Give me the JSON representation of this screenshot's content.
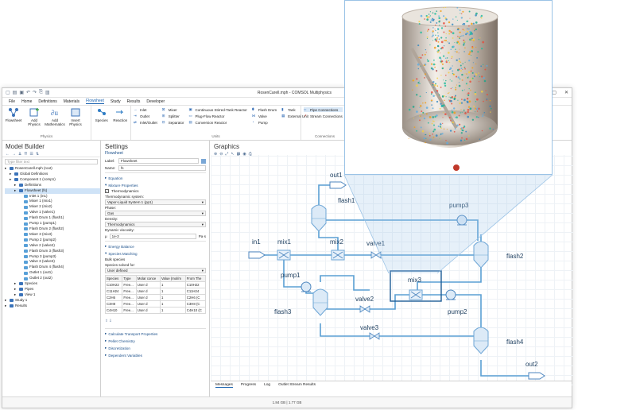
{
  "window": {
    "title": "RosenCarell.mph - COMSOL Multiphysics"
  },
  "menu": [
    "File",
    "Home",
    "Definitions",
    "Materials",
    "Flowsheet",
    "Study",
    "Results",
    "Developer"
  ],
  "menu_active": "Flowsheet",
  "ribbon": {
    "groups": [
      {
        "label": "Physics",
        "buttons": [
          "Flowsheet",
          "Add Physics",
          "Add Mathematics",
          "Insert Physics"
        ]
      },
      {
        "label": "",
        "buttons": [
          "Species",
          "Reaction"
        ]
      },
      {
        "label": "Units",
        "col1": [
          "Inlet",
          "Outlet",
          "Inlet/Outlet"
        ],
        "col2": [
          "Mixer",
          "Splitter",
          "Separator"
        ],
        "col3": [
          "Continuous Stirred-Tank Reactor",
          "Plug-Flow Reactor",
          "Conversion Reactor"
        ],
        "col4": [
          "Flash Drum",
          "Valve",
          "Pump"
        ],
        "col5": [
          "Tank",
          "External Unit"
        ]
      },
      {
        "label": "Connections",
        "col1": [
          "Pipe Connections",
          "Stream Connections"
        ]
      }
    ]
  },
  "model_builder": {
    "title": "Model Builder",
    "filter_placeholder": "Type filter text",
    "tree": [
      {
        "label": "RosenCarell.mph (root)",
        "level": 0,
        "color": "#3b73b9"
      },
      {
        "label": "Global Definitions",
        "level": 1,
        "color": "#3b73b9"
      },
      {
        "label": "Component 1 (comp1)",
        "level": 1,
        "color": "#3b73b9"
      },
      {
        "label": "Definitions",
        "level": 2,
        "color": "#3b73b9"
      },
      {
        "label": "Flowsheet (fs)",
        "level": 2,
        "color": "#3b73b9",
        "selected": true
      },
      {
        "label": "Inlet 1 (in1)",
        "level": 3,
        "color": "#58a0d8"
      },
      {
        "label": "Mixer 1 (mix1)",
        "level": 3,
        "color": "#58a0d8"
      },
      {
        "label": "Mixer 2 (mix2)",
        "level": 3,
        "color": "#58a0d8"
      },
      {
        "label": "Valve 1 (valve1)",
        "level": 3,
        "color": "#58a0d8"
      },
      {
        "label": "Flash Drum 1 (flash1)",
        "level": 3,
        "color": "#58a0d8"
      },
      {
        "label": "Pump 1 (pump1)",
        "level": 3,
        "color": "#58a0d8"
      },
      {
        "label": "Flash Drum 2 (flash2)",
        "level": 3,
        "color": "#58a0d8"
      },
      {
        "label": "Mixer 3 (mix3)",
        "level": 3,
        "color": "#58a0d8"
      },
      {
        "label": "Pump 2 (pump2)",
        "level": 3,
        "color": "#58a0d8"
      },
      {
        "label": "Valve 2 (valve2)",
        "level": 3,
        "color": "#58a0d8"
      },
      {
        "label": "Flash Drum 3 (flash3)",
        "level": 3,
        "color": "#58a0d8"
      },
      {
        "label": "Pump 3 (pump3)",
        "level": 3,
        "color": "#58a0d8"
      },
      {
        "label": "Valve 3 (valve3)",
        "level": 3,
        "color": "#58a0d8"
      },
      {
        "label": "Flash Drum 4 (flash4)",
        "level": 3,
        "color": "#58a0d8"
      },
      {
        "label": "Outlet 1 (out1)",
        "level": 3,
        "color": "#58a0d8"
      },
      {
        "label": "Outlet 2 (out2)",
        "level": 3,
        "color": "#58a0d8"
      },
      {
        "label": "Species",
        "level": 2,
        "color": "#3b73b9"
      },
      {
        "label": "Pipes",
        "level": 2,
        "color": "#3b73b9"
      },
      {
        "label": "View 1",
        "level": 2,
        "color": "#3b73b9"
      },
      {
        "label": "Study 1",
        "level": 0,
        "color": "#3b73b9"
      },
      {
        "label": "Results",
        "level": 0,
        "color": "#3b73b9"
      }
    ]
  },
  "settings": {
    "title": "Settings",
    "subtitle": "Flowsheet",
    "label_field": {
      "label": "Label:",
      "value": "Flowsheet"
    },
    "name_field": {
      "label": "Name:",
      "value": "fs"
    },
    "sections": {
      "equation": "Equation",
      "mixture": "Mixture Properties",
      "energy": "Energy Balance",
      "species_matching": "Species Matching",
      "transport": "Calculate Transport Properties",
      "pellet": "Pellet Chemistry",
      "discretization": "Discretization",
      "dependent": "Dependent Variables"
    },
    "thermo_checkbox": "Thermodynamics",
    "thermo_system_label": "Thermodynamic system:",
    "thermo_system_value": "Vapor-Liquid System 1 (pp1)",
    "phase_label": "Phase:",
    "phase_value": "Gas",
    "density_label": "Density:",
    "density_value": "Thermodynamics",
    "viscosity_label": "Dynamic viscosity:",
    "viscosity_symbol": "μ",
    "viscosity_value": "1e-3",
    "viscosity_unit": "Pa·s",
    "bulk_species": "Bulk species",
    "species_solved_label": "Species solved for:",
    "species_solved_value": "User defined",
    "table_headers": [
      "Species",
      "Type",
      "Molar conce",
      "Value (mol/m",
      "From The"
    ],
    "table_rows": [
      [
        "C10H22",
        "Free...",
        "User d",
        "1",
        "C10H22"
      ],
      [
        "C11H24",
        "Free...",
        "User d",
        "1",
        "C11H24"
      ],
      [
        "C2H6",
        "Free...",
        "User d",
        "1",
        "C2H6 (C"
      ],
      [
        "C3H8",
        "Free...",
        "User d",
        "1",
        "C3H8 (C"
      ],
      [
        "C4H10",
        "Free...",
        "User d",
        "1",
        "C4H10 (C"
      ]
    ]
  },
  "graphics": {
    "title": "Graphics",
    "units": {
      "in1": "in1",
      "mix1": "mix1",
      "mix2": "mix2",
      "mix3": "mix3",
      "valve1": "valve1",
      "valve2": "valve2",
      "valve3": "valve3",
      "flash1": "flash1",
      "flash2": "flash2",
      "flash3": "flash3",
      "flash4": "flash4",
      "pump1": "pump1",
      "pump2": "pump2",
      "pump3": "pump3",
      "out1": "out1",
      "out2": "out2"
    },
    "stream_color": "#5a9fd4",
    "highlight_color": "#1f5d97"
  },
  "bottom_tabs": [
    "Messages",
    "Progress",
    "Log",
    "Outlet Stream Results"
  ],
  "status": "1.84 GB | 1.77 GB"
}
